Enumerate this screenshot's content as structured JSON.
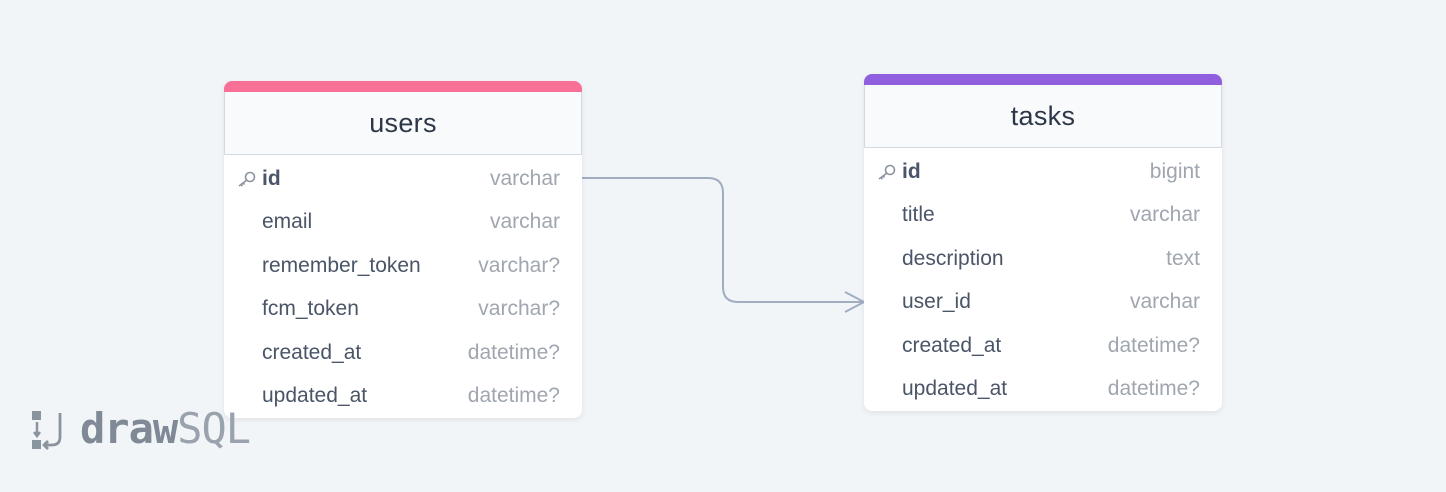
{
  "diagram": {
    "tables": [
      {
        "id": "users",
        "name": "users",
        "accent": "#f87096",
        "columns": [
          {
            "name": "id",
            "type": "varchar",
            "pk": true
          },
          {
            "name": "email",
            "type": "varchar"
          },
          {
            "name": "remember_token",
            "type": "varchar?"
          },
          {
            "name": "fcm_token",
            "type": "varchar?"
          },
          {
            "name": "created_at",
            "type": "datetime?"
          },
          {
            "name": "updated_at",
            "type": "datetime?"
          }
        ]
      },
      {
        "id": "tasks",
        "name": "tasks",
        "accent": "#8f5fe0",
        "columns": [
          {
            "name": "id",
            "type": "bigint",
            "pk": true
          },
          {
            "name": "title",
            "type": "varchar"
          },
          {
            "name": "description",
            "type": "text"
          },
          {
            "name": "user_id",
            "type": "varchar"
          },
          {
            "name": "created_at",
            "type": "datetime?"
          },
          {
            "name": "updated_at",
            "type": "datetime?"
          }
        ]
      }
    ],
    "relations": [
      {
        "from": "users.id",
        "to": "tasks.user_id",
        "type": "one-to-many"
      }
    ],
    "connector_color": "#a0aec0"
  },
  "logo": {
    "bold": "draw",
    "light": "SQL"
  }
}
